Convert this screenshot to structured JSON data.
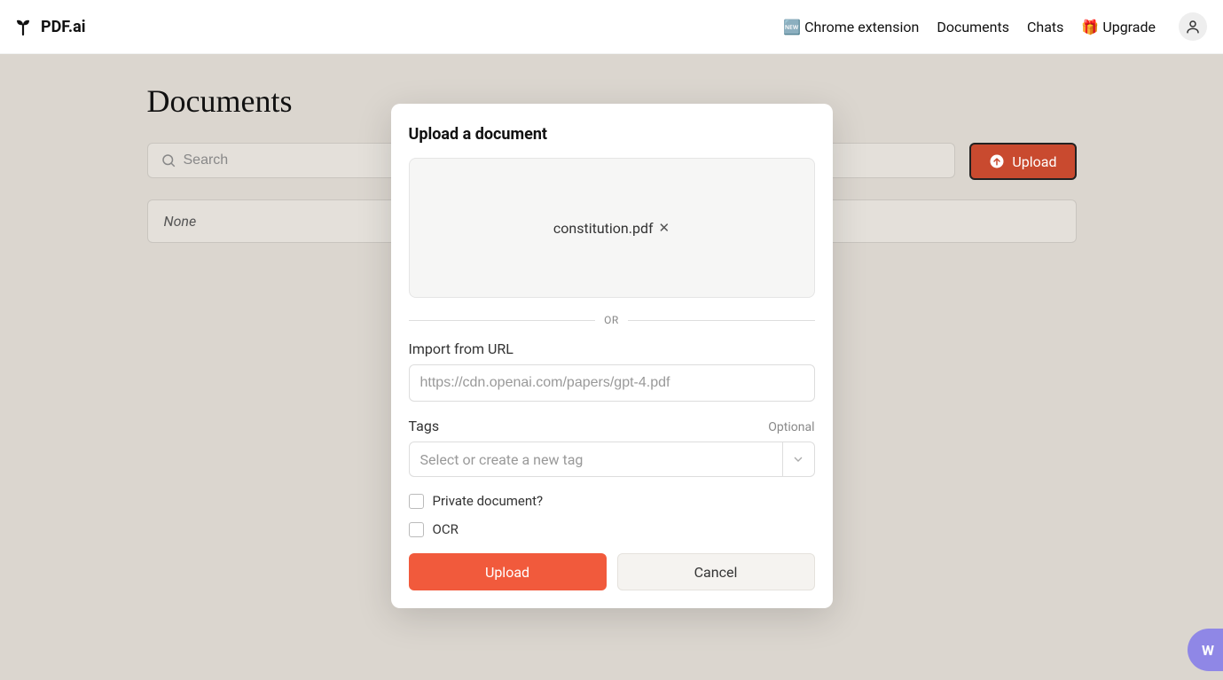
{
  "brand": {
    "name": "PDF.ai"
  },
  "nav": {
    "chrome_emoji": "🆕",
    "chrome": "Chrome extension",
    "documents": "Documents",
    "chats": "Chats",
    "upgrade_emoji": "🎁",
    "upgrade": "Upgrade"
  },
  "page": {
    "title": "Documents",
    "search_placeholder": "Search",
    "upload_button": "Upload",
    "none_text": "None"
  },
  "modal": {
    "title": "Upload a document",
    "file_name": "constitution.pdf",
    "or_text": "OR",
    "import_label": "Import from URL",
    "import_placeholder": "https://cdn.openai.com/papers/gpt-4.pdf",
    "tags_label": "Tags",
    "tags_optional": "Optional",
    "tags_placeholder": "Select or create a new tag",
    "private_label": "Private document?",
    "ocr_label": "OCR",
    "upload_btn": "Upload",
    "cancel_btn": "Cancel"
  },
  "fab": {
    "label": "W"
  }
}
